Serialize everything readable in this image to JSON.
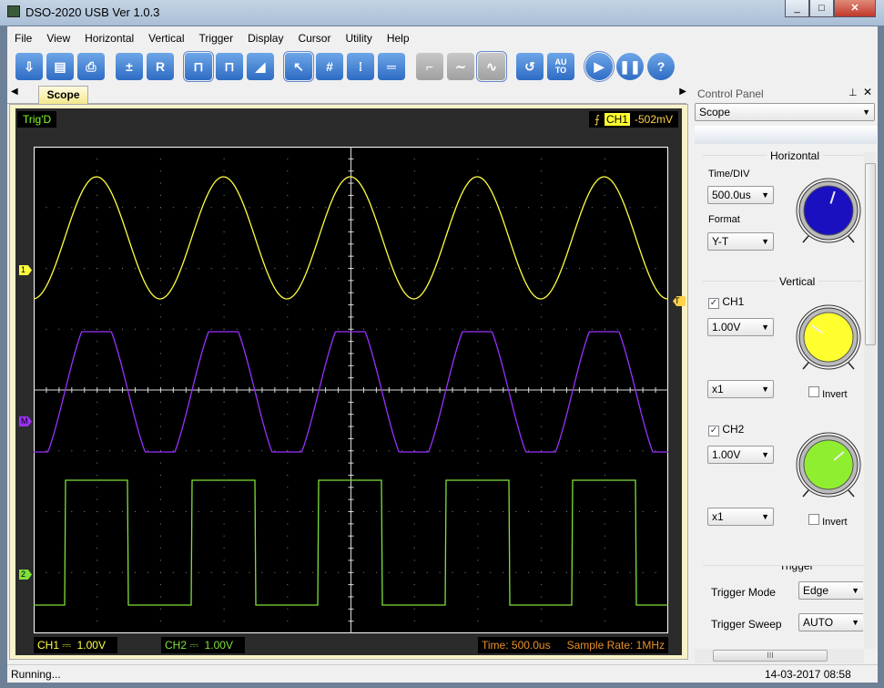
{
  "window": {
    "title": "DSO-2020 USB Ver 1.0.3",
    "controls": [
      "_",
      "□",
      "✕"
    ]
  },
  "menu": [
    "File",
    "View",
    "Horizontal",
    "Vertical",
    "Trigger",
    "Display",
    "Cursor",
    "Utility",
    "Help"
  ],
  "toolbar": [
    {
      "icon": "open-icon",
      "glyph": "⇩",
      "style": ""
    },
    {
      "icon": "save-icon",
      "glyph": "▤",
      "style": ""
    },
    {
      "icon": "print-icon",
      "glyph": "⎙",
      "style": ""
    },
    {
      "sep": true
    },
    {
      "icon": "math-icon",
      "glyph": "±",
      "style": ""
    },
    {
      "icon": "reference-icon",
      "glyph": "R",
      "style": ""
    },
    {
      "sep": true
    },
    {
      "icon": "pulse-icon",
      "glyph": "⊓",
      "style": "sel"
    },
    {
      "icon": "multi-pulse-icon",
      "glyph": "⊓",
      "style": ""
    },
    {
      "icon": "ramp-icon",
      "glyph": "◢",
      "style": ""
    },
    {
      "sep": true
    },
    {
      "icon": "pointer-icon",
      "glyph": "↖",
      "style": "sel"
    },
    {
      "icon": "grid-icon",
      "glyph": "#",
      "style": ""
    },
    {
      "icon": "vertical-cursor-icon",
      "glyph": "⁞",
      "style": ""
    },
    {
      "icon": "horizontal-cursor-icon",
      "glyph": "═",
      "style": ""
    },
    {
      "sep": true
    },
    {
      "icon": "step-icon",
      "glyph": "⌐",
      "style": "g"
    },
    {
      "icon": "wave-icon",
      "glyph": "∼",
      "style": "g"
    },
    {
      "icon": "sine-icon",
      "glyph": "∿",
      "style": "g sel"
    },
    {
      "sep": true
    },
    {
      "icon": "reset-icon",
      "glyph": "↺",
      "style": ""
    },
    {
      "icon": "auto-icon",
      "glyph": "AU TO",
      "style": ""
    },
    {
      "sep": true
    },
    {
      "icon": "run-icon",
      "glyph": "▶",
      "style": "round sel"
    },
    {
      "icon": "pause-icon",
      "glyph": "❚❚",
      "style": "round"
    },
    {
      "icon": "help-icon",
      "glyph": "?",
      "style": "round"
    }
  ],
  "tab": "Scope",
  "scope": {
    "status": "Trig'D",
    "trigger_channel": "CH1",
    "trigger_level": "-502mV",
    "ch1": {
      "label": "CH1",
      "coupling": "⎓",
      "scale": "1.00V",
      "color": "#ffff40"
    },
    "ch2": {
      "label": "CH2",
      "coupling": "⎓",
      "scale": "1.00V",
      "color": "#7fe03a"
    },
    "math_color": "#9a30ff",
    "markers": {
      "ch1": "1",
      "math": "M",
      "ch2": "2",
      "trigger": "T"
    },
    "time": "Time: 500.0us",
    "sample_rate": "Sample Rate: 1MHz"
  },
  "control_panel": {
    "title": "Control Panel",
    "mode": "Scope",
    "horizontal": {
      "title": "Horizontal",
      "time_div_label": "Time/DIV",
      "time_div": "500.0us",
      "format_label": "Format",
      "format": "Y-T",
      "knob_color": "#1a10c0"
    },
    "vertical": {
      "title": "Vertical",
      "ch1": {
        "label": "CH1",
        "checked": true,
        "volts": "1.00V",
        "probe": "x1",
        "invert_label": "Invert",
        "invert": false,
        "knob_color": "#ffff30"
      },
      "ch2": {
        "label": "CH2",
        "checked": true,
        "volts": "1.00V",
        "probe": "x1",
        "invert_label": "Invert",
        "invert": false,
        "knob_color": "#90ee30"
      }
    },
    "trigger": {
      "title": "Trigger",
      "mode_label": "Trigger Mode",
      "mode": "Edge",
      "sweep_label": "Trigger Sweep",
      "sweep": "AUTO"
    }
  },
  "statusbar": {
    "text": "Running...",
    "datetime": "14-03-2017  08:58"
  }
}
